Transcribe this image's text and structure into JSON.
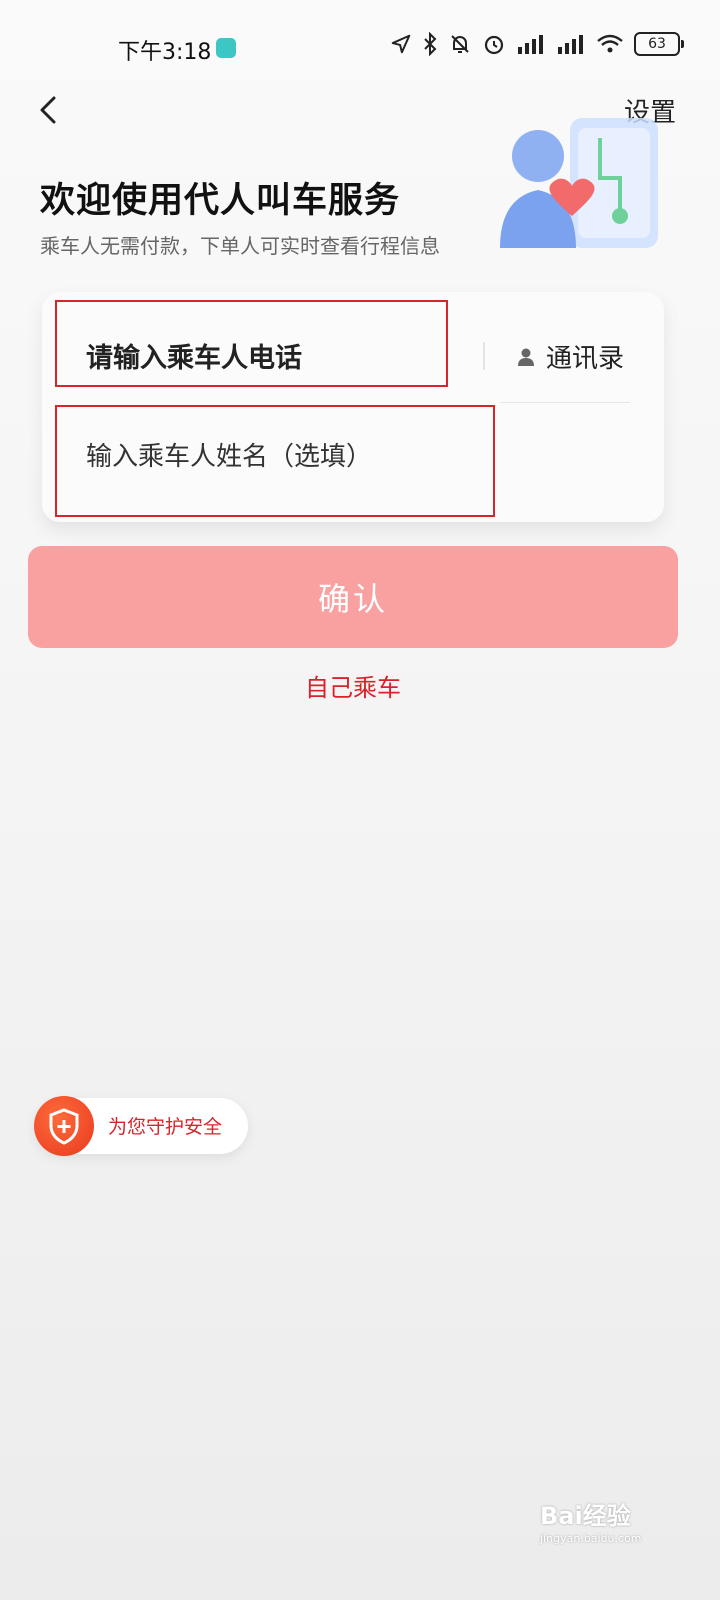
{
  "status_bar": {
    "time": "下午3:18",
    "battery": "63",
    "icons": [
      "location-icon",
      "bluetooth-icon",
      "mute-icon",
      "alarm-icon",
      "signal-icon",
      "signal-icon",
      "wifi-icon",
      "battery-icon"
    ]
  },
  "header": {
    "back_icon": "chevron-left-icon",
    "settings_label": "设置"
  },
  "hero": {
    "title": "欢迎使用代人叫车服务",
    "subtitle": "乘车人无需付款，下单人可实时查看行程信息"
  },
  "form": {
    "phone_placeholder": "请输入乘车人电话",
    "contacts_label": "通讯录",
    "name_placeholder": "输入乘车人姓名（选填）"
  },
  "actions": {
    "confirm_label": "确认",
    "self_ride_label": "自己乘车"
  },
  "safety": {
    "label": "为您守护安全"
  },
  "watermark": {
    "brand": "Bai经验",
    "url": "jingyan.baidu.com"
  },
  "colors": {
    "accent": "#d8232a",
    "confirm_bg": "#f9a1a1"
  }
}
